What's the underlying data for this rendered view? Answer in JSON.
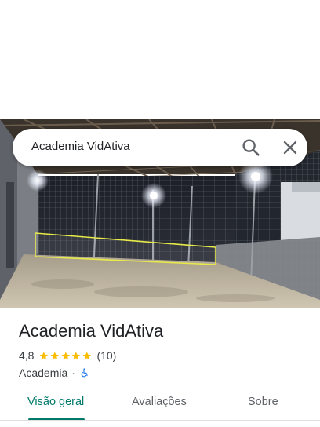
{
  "search": {
    "query": "Academia VidAtiva"
  },
  "place": {
    "title": "Academia VidAtiva",
    "rating": "4,8",
    "stars_filled": 5,
    "review_count": "(10)",
    "category": "Academia",
    "separator": "·",
    "accessibility_icon": "wheelchair-icon"
  },
  "tabs": [
    {
      "label": "Visão geral",
      "active": true
    },
    {
      "label": "Avaliações",
      "active": false
    },
    {
      "label": "Sobre",
      "active": false
    }
  ],
  "colors": {
    "accent": "#00796b",
    "star": "#fbbc04",
    "accessibility": "#1a73e8"
  },
  "icons": {
    "search": "search-icon",
    "close": "close-icon"
  }
}
